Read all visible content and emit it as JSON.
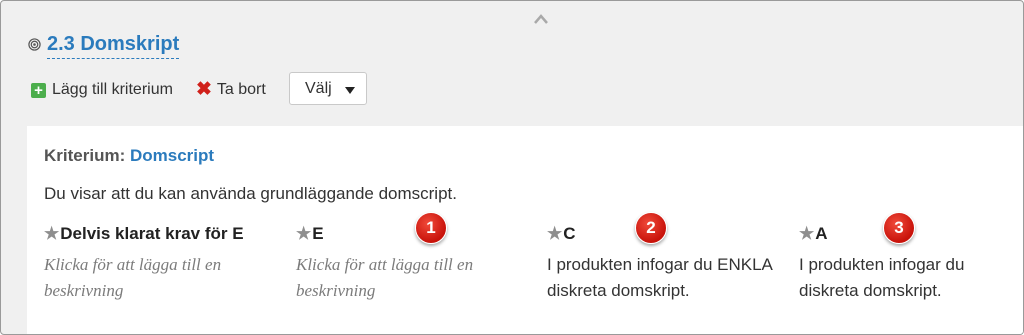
{
  "section": {
    "title": "2.3 Domskript"
  },
  "toolbar": {
    "add_label": "Lägg till kriterium",
    "remove_label": "Ta bort",
    "select_value": "Välj"
  },
  "criterion": {
    "label": "Kriterium:",
    "name": "Domscript",
    "description": "Du visar att du kan använda grundläggande domscript."
  },
  "levels": [
    {
      "heading": "Delvis klarat krav för E",
      "text": "Klicka för att lägga till en beskrivning",
      "placeholder": true
    },
    {
      "heading": "E",
      "text": "Klicka för att lägga till en beskrivning",
      "placeholder": true
    },
    {
      "heading": "C",
      "text": "I produkten infogar du ENKLA diskreta domskript.",
      "placeholder": false
    },
    {
      "heading": "A",
      "text": "I produkten infogar du diskreta domskript.",
      "placeholder": false
    }
  ],
  "badges": [
    "1",
    "2",
    "3"
  ],
  "icons": {
    "collapse": "chevron-up-icon",
    "section": "target-icon",
    "add": "plus-icon",
    "remove": "x-icon",
    "dropdown": "caret-down-icon",
    "level": "star-icon"
  },
  "colors": {
    "link": "#2b7bbd",
    "add": "#4cae4c",
    "remove": "#d0201a",
    "badge": "#d6231b"
  }
}
